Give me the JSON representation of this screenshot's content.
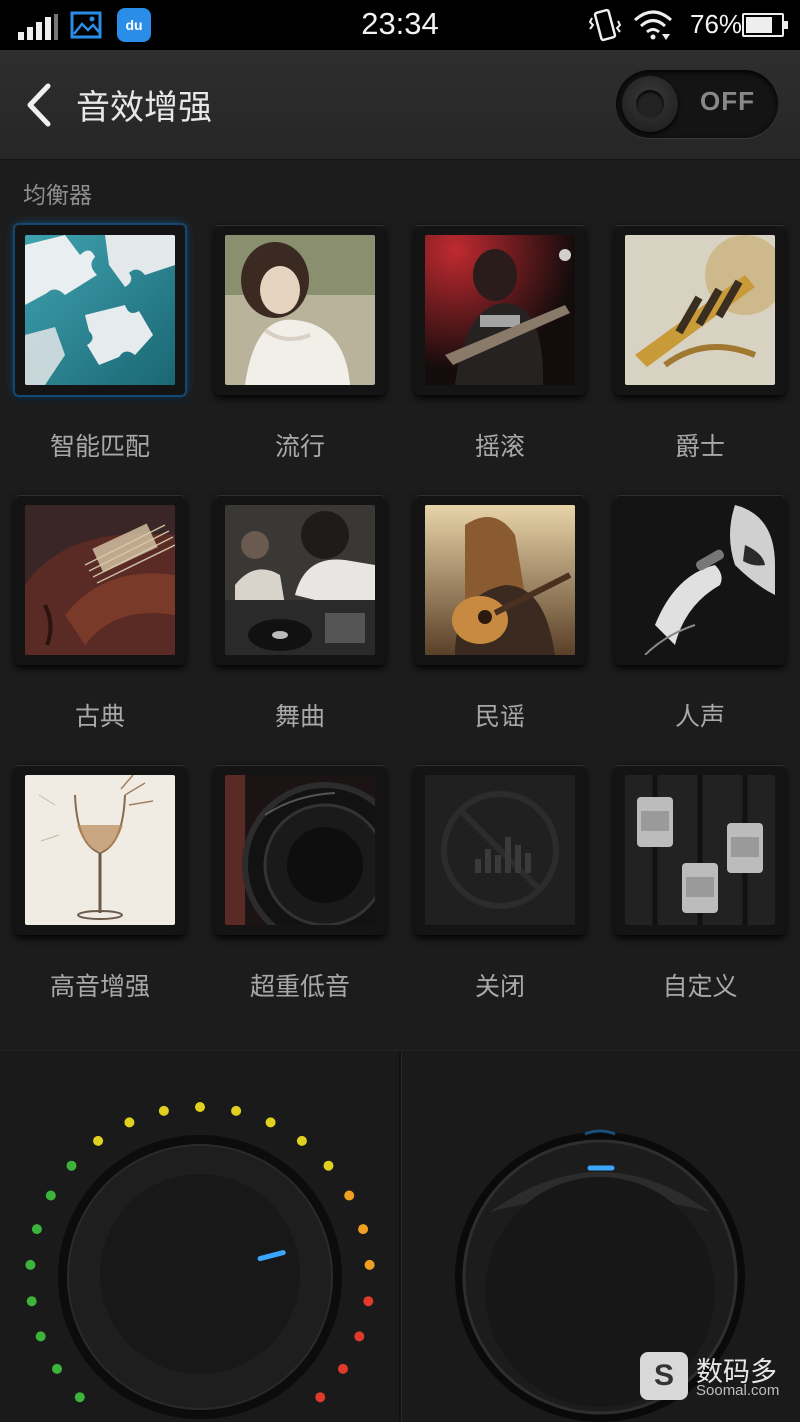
{
  "status_bar": {
    "time": "23:34",
    "battery_text": "76%",
    "battery_level": 0.76,
    "du_label": "du",
    "icons": [
      "signal-icon",
      "gallery-icon",
      "du-app-icon",
      "vibrate-icon",
      "wifi-icon",
      "battery-icon"
    ]
  },
  "header": {
    "title": "音效增强",
    "toggle_label": "OFF",
    "toggle_state": "off"
  },
  "equalizer": {
    "section_label": "均衡器",
    "presets": [
      {
        "label": "智能匹配",
        "selected": true
      },
      {
        "label": "流行",
        "selected": false
      },
      {
        "label": "摇滚",
        "selected": false
      },
      {
        "label": "爵士",
        "selected": false
      },
      {
        "label": "古典",
        "selected": false
      },
      {
        "label": "舞曲",
        "selected": false
      },
      {
        "label": "民谣",
        "selected": false
      },
      {
        "label": "人声",
        "selected": false
      },
      {
        "label": "高音增强",
        "selected": false
      },
      {
        "label": "超重低音",
        "selected": false
      },
      {
        "label": "关闭",
        "selected": false
      },
      {
        "label": "自定义",
        "selected": false
      }
    ]
  },
  "colors": {
    "accent": "#1d6aa6",
    "knob_indicator": "#3aa6ff",
    "led_green": "#3cb43c",
    "led_yellow": "#e0d020",
    "led_orange": "#f0a020",
    "led_red": "#e03a2a"
  },
  "knobs": {
    "left_level": 0.78,
    "right_level": 0.5
  },
  "watermark": {
    "logo_letter": "S",
    "title": "数码多",
    "subtitle": "Soomal.com"
  }
}
